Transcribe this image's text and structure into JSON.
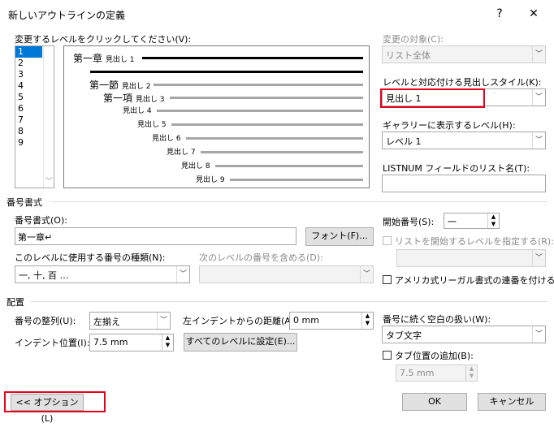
{
  "dialog": {
    "title": "新しいアウトラインの定義",
    "help": "?",
    "close": "✕"
  },
  "levels": {
    "label": "変更するレベルをクリックしてください(V):",
    "items": [
      "1",
      "2",
      "3",
      "4",
      "5",
      "6",
      "7",
      "8",
      "9"
    ],
    "selected": "1"
  },
  "preview": {
    "items": [
      {
        "num": "第一章",
        "text": "見出し 1"
      },
      {
        "num": "第一節",
        "text": "見出し 2"
      },
      {
        "num": "第一項",
        "text": "見出し 3"
      },
      {
        "num": "",
        "text": "見出し 4"
      },
      {
        "num": "",
        "text": "見出し 5"
      },
      {
        "num": "",
        "text": "見出し 6"
      },
      {
        "num": "",
        "text": "見出し 7"
      },
      {
        "num": "",
        "text": "見出し 8"
      },
      {
        "num": "",
        "text": "見出し 9"
      }
    ]
  },
  "right": {
    "apply_to_label": "変更の対象(C):",
    "apply_to_value": "リスト全体",
    "link_style_label": "レベルと対応付ける見出しスタイル(K):",
    "link_style_value": "見出し 1",
    "gallery_label": "ギャラリーに表示するレベル(H):",
    "gallery_value": "レベル 1",
    "listnum_label": "LISTNUM フィールドのリスト名(T):",
    "listnum_value": ""
  },
  "numfmt": {
    "section": "番号書式",
    "format_label": "番号書式(O):",
    "format_value": "第一章↵",
    "font_button": "フォント(F)...",
    "style_label": "このレベルに使用する番号の種類(N):",
    "style_value": "一, 十, 百 …",
    "include_label": "次のレベルの番号を含める(D):",
    "include_value": "",
    "start_label": "開始番号(S):",
    "start_value": "一",
    "restart_label": "リストを開始するレベルを指定する(R):",
    "restart_value": "",
    "legal_label": "アメリカ式リーガル書式の連番を付ける(G)"
  },
  "position": {
    "section": "配置",
    "align_label": "番号の整列(U):",
    "align_value": "左揃え",
    "indent_label": "左インデントからの距離(A):",
    "indent_value": "0 mm",
    "tab_label": "インデント位置(I):",
    "tab_value": "7.5 mm",
    "set_all_button": "すべてのレベルに設定(E)...",
    "follow_label": "番号に続く空白の扱い(W):",
    "follow_value": "タブ文字",
    "tabstop_label": "タブ位置の追加(B):",
    "tabstop_value": "7.5 mm"
  },
  "footer": {
    "options_button": "<< オプション(L)",
    "ok_button": "OK",
    "cancel_button": "キャンセル"
  },
  "colors": {
    "highlight": "#e8001c",
    "selection": "#0078d7"
  }
}
